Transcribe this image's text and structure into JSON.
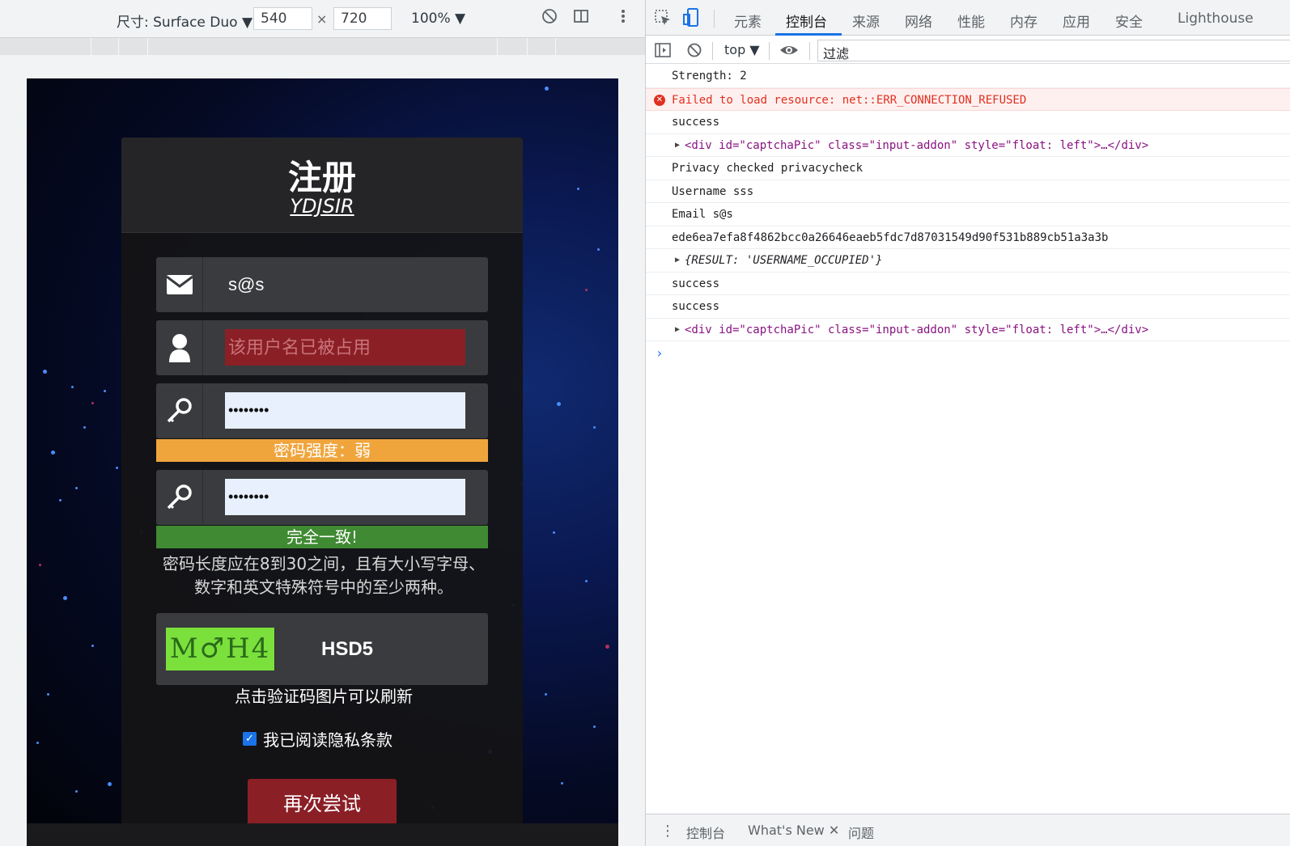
{
  "device_toolbar": {
    "dimensions_label": "尺寸: Surface Duo ▼",
    "width": "540",
    "height": "720",
    "times": "×",
    "zoom": "100% ▼"
  },
  "page": {
    "title": "注册",
    "subtitle": "YDJSIR",
    "email_value": "s@s",
    "username_placeholder": "该用户名已被占用",
    "password_mask": "••••••••",
    "confirm_mask": "••••••••",
    "strength_text": "密码强度：弱",
    "match_text": "完全一致!",
    "rule_text": "密码长度应在8到30之间，且有大小写字母、数字和英文特殊符号中的至少两种。",
    "captcha_image_text": "M♂H4",
    "captcha_value": "HSD5",
    "captcha_hint": "点击验证码图片可以刷新",
    "privacy_label": "我已阅读隐私条款",
    "privacy_checked": true,
    "retry_button": "再次尝试",
    "colors": {
      "strength_bar": "#f0a53c",
      "match_bar": "#3f8a33",
      "error_field": "#8b1f26",
      "button": "#8b1f26",
      "captcha_bg": "#7be03c"
    }
  },
  "devtools": {
    "tabs": [
      "元素",
      "控制台",
      "来源",
      "网络",
      "性能",
      "内存",
      "应用",
      "安全",
      "Lighthouse"
    ],
    "active_tab": "控制台",
    "context": "top ▼",
    "filter_placeholder": "过滤",
    "console": [
      {
        "type": "log",
        "text": "Strength: 2"
      },
      {
        "type": "error",
        "text": "Failed to load resource: net::ERR_CONNECTION_REFUSED"
      },
      {
        "type": "log",
        "text": "success"
      },
      {
        "type": "element",
        "text": "<div id=\"captchaPic\" class=\"input-addon\" style=\"float: left\">…</div>"
      },
      {
        "type": "log",
        "text": "Privacy checked privacycheck"
      },
      {
        "type": "log",
        "text": "Username sss"
      },
      {
        "type": "log",
        "text": "Email s@s"
      },
      {
        "type": "log",
        "text": "ede6ea7efa8f4862bcc0a26646eaeb5fdc7d87031549d90f531b889cb51a3a3b"
      },
      {
        "type": "object",
        "text": "{RESULT: 'USERNAME_OCCUPIED'}"
      },
      {
        "type": "log",
        "text": "success"
      },
      {
        "type": "log",
        "text": "success"
      },
      {
        "type": "element",
        "text": "<div id=\"captchaPic\" class=\"input-addon\" style=\"float: left\">…</div>"
      }
    ],
    "prompt": "›",
    "drawer_tabs": [
      "控制台",
      "What's New ✕",
      "问题"
    ]
  }
}
